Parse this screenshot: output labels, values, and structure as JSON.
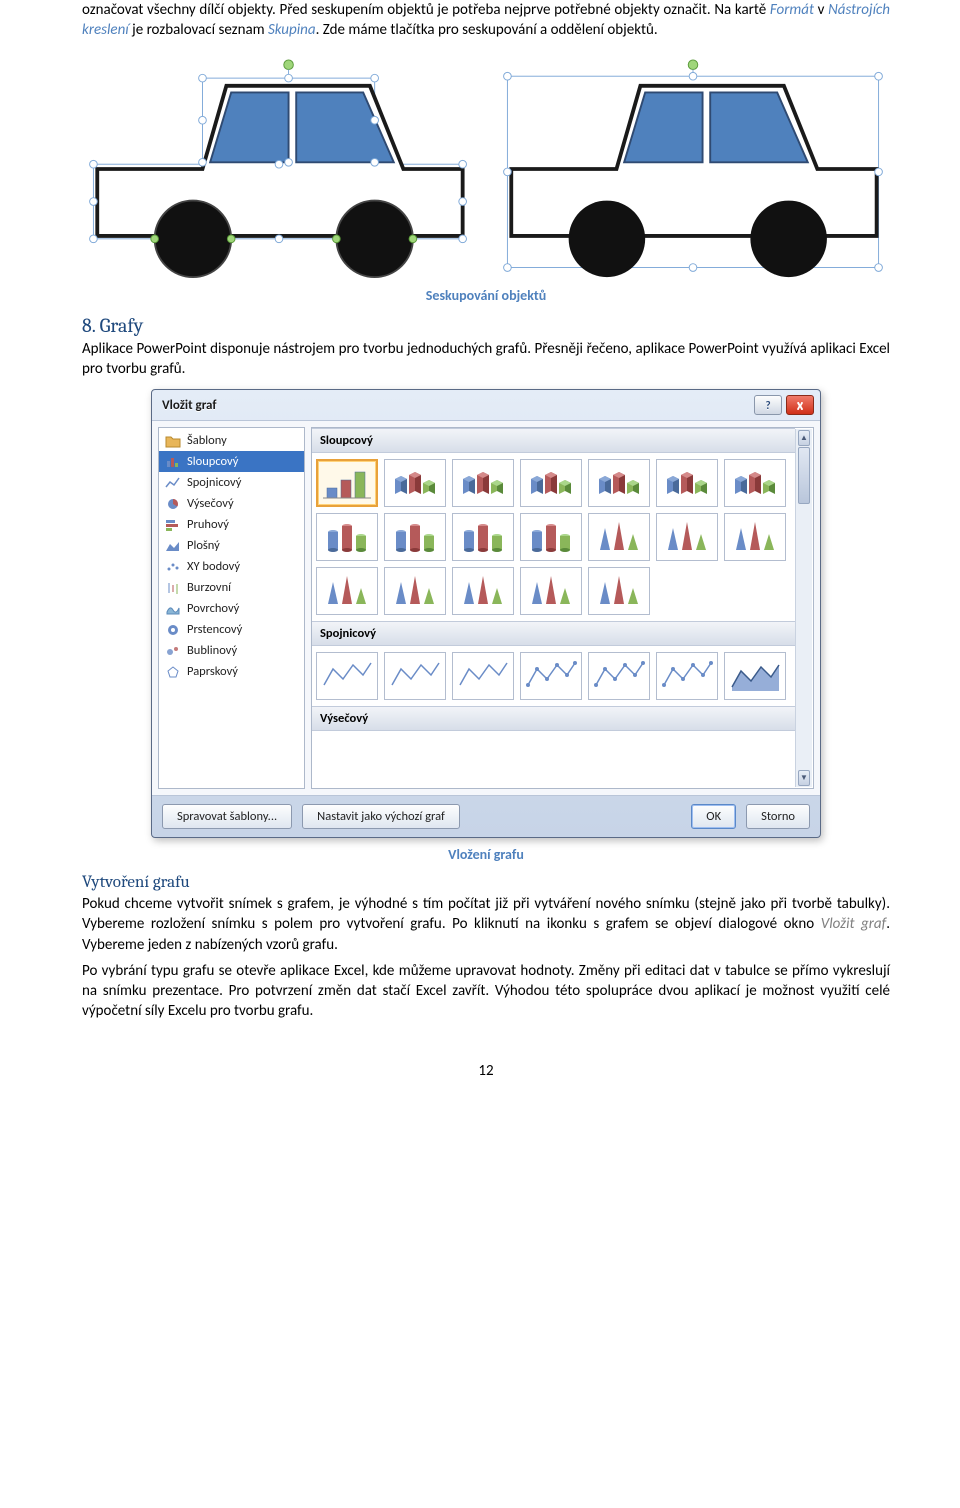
{
  "para1_a": "označovat všechny dílčí objekty. Před seskupením objektů je potřeba nejprve potřebné objekty označit. Na kartě ",
  "para1_b": "Formát",
  "para1_c": " v ",
  "para1_d": "Nástrojích kreslení",
  "para1_e": " je rozbalovací seznam ",
  "para1_f": "Skupina",
  "para1_g": ". Zde máme tlačítka pro seskupování a oddělení objektů.",
  "caption1": "Seskupování objektů",
  "h2": "8. Grafy",
  "para2": "Aplikace PowerPoint disponuje nástrojem pro tvorbu jednoduchých grafů. Přesněji řečeno, aplikace PowerPoint využívá aplikaci Excel pro tvorbu grafů.",
  "dialog": {
    "title": "Vložit graf",
    "help": "?",
    "close": "X",
    "categories": [
      {
        "label": "Šablony",
        "icon": "folder",
        "color": "#D9A441"
      },
      {
        "label": "Sloupcový",
        "icon": "bars",
        "color": "#6A8CC7",
        "selected": true
      },
      {
        "label": "Spojnicový",
        "icon": "line",
        "color": "#6A8CC7"
      },
      {
        "label": "Výsečový",
        "icon": "pie",
        "color": "#6A8CC7"
      },
      {
        "label": "Pruhový",
        "icon": "hbar",
        "color": "#6A8CC7"
      },
      {
        "label": "Plošný",
        "icon": "area",
        "color": "#6A8CC7"
      },
      {
        "label": "XY bodový",
        "icon": "scatter",
        "color": "#6A8CC7"
      },
      {
        "label": "Burzovní",
        "icon": "stock",
        "color": "#6A8CC7"
      },
      {
        "label": "Povrchový",
        "icon": "surface",
        "color": "#6A8CC7"
      },
      {
        "label": "Prstencový",
        "icon": "donut",
        "color": "#6A8CC7"
      },
      {
        "label": "Bublinový",
        "icon": "bubble",
        "color": "#6A8CC7"
      },
      {
        "label": "Paprskový",
        "icon": "radar",
        "color": "#6A8CC7"
      }
    ],
    "groups": [
      {
        "header": "Sloupcový",
        "thumbs": 7,
        "rows": 3,
        "selectedIndex": 0
      },
      {
        "header": "Spojnicový",
        "thumbs": 7,
        "rows": 1
      },
      {
        "header": "Výsečový",
        "thumbs": 0,
        "rows": 0
      }
    ],
    "buttons": {
      "manage": "Spravovat šablony...",
      "default": "Nastavit jako výchozí graf",
      "ok": "OK",
      "cancel": "Storno"
    }
  },
  "caption2": "Vložení grafu",
  "h3": "Vytvoření grafu",
  "para3_a": "Pokud chceme vytvořit snímek s grafem, je výhodné s tím počítat již při vytváření nového snímku (stejně jako při tvorbě tabulky). Vybereme rozložení snímku s polem pro vytvoření grafu. Po kliknutí na ikonku s grafem se objeví dialogové okno ",
  "para3_b": "Vložit graf",
  "para3_c": ". Vybereme jeden z nabízených vzorů grafu.",
  "para4": "Po vybrání typu grafu se otevře aplikace Excel, kde můžeme upravovat hodnoty. Změny při editaci dat v tabulce se přímo vykreslují na snímku prezentace. Pro potvrzení změn dat stačí Excel zavřít. Výhodou této spolupráce dvou aplikací je možnost využití celé výpočetní síly Excelu pro tvorbu grafu.",
  "pagenum": "12"
}
